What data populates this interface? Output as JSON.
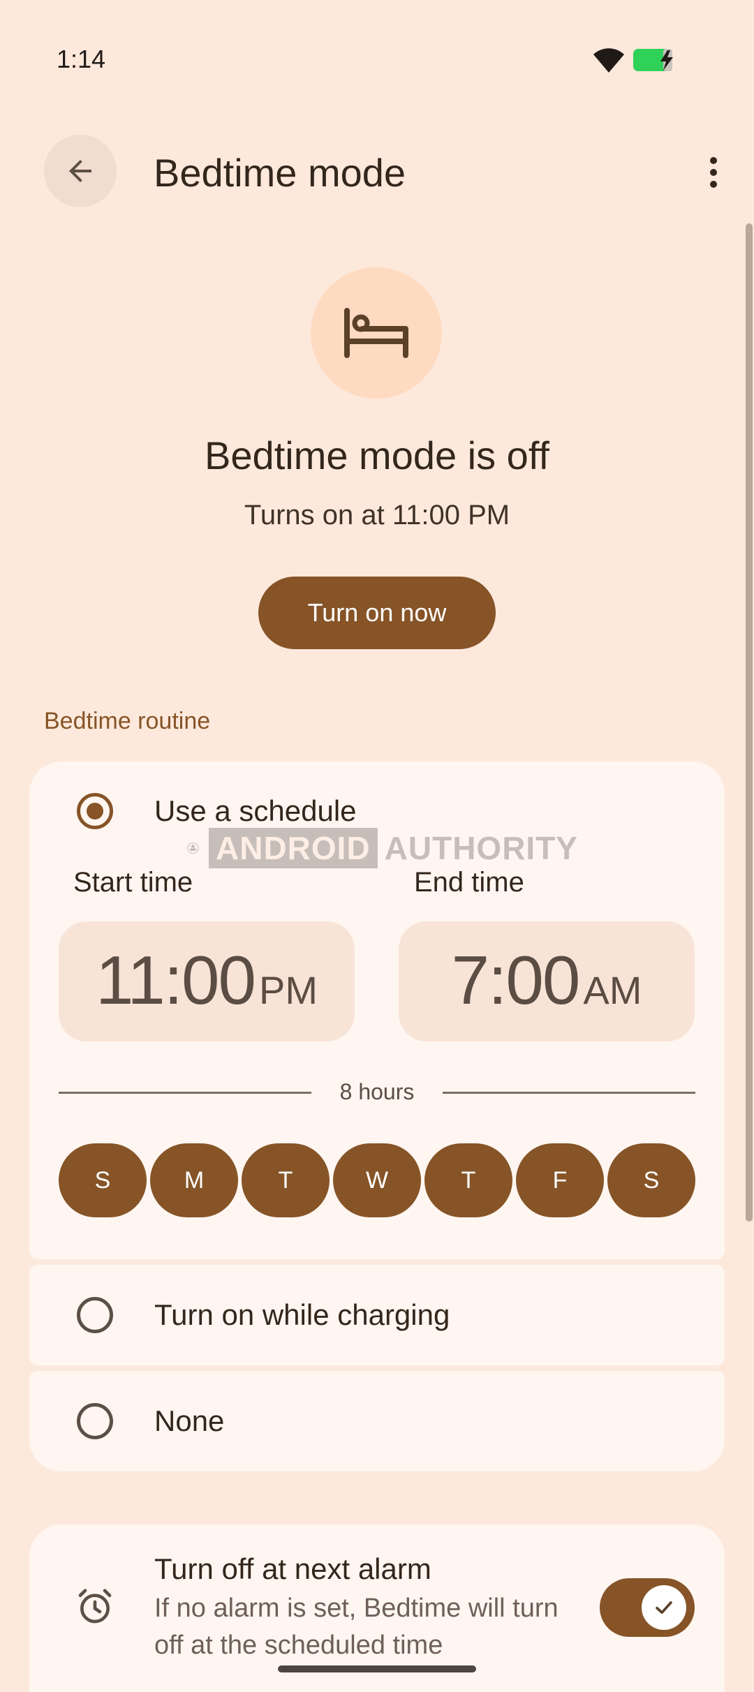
{
  "status_bar": {
    "time": "1:14"
  },
  "app_bar": {
    "title": "Bedtime mode"
  },
  "hero": {
    "title": "Bedtime mode is off",
    "subtitle": "Turns on at 11:00 PM",
    "button_label": "Turn on now"
  },
  "routine": {
    "section_label": "Bedtime routine",
    "options": [
      {
        "label": "Use a schedule",
        "selected": true
      },
      {
        "label": "Turn on while charging",
        "selected": false
      },
      {
        "label": "None",
        "selected": false
      }
    ],
    "start_label": "Start time",
    "start_time": "11:00",
    "start_ampm": "PM",
    "end_label": "End time",
    "end_time": "7:00",
    "end_ampm": "AM",
    "duration": "8 hours",
    "days": [
      "S",
      "M",
      "T",
      "W",
      "T",
      "F",
      "S"
    ]
  },
  "alarm": {
    "title": "Turn off at next alarm",
    "description": "If no alarm is set, Bedtime will turn off at the scheduled time",
    "toggle_on": true
  },
  "watermark": {
    "text1": "ANDROID",
    "text2": "AUTHORITY"
  },
  "colors": {
    "background": "#fde9dc",
    "accent": "#865427",
    "card": "#fff6f1",
    "time_box": "#f8e4d7",
    "icon_circle": "#fedac1"
  }
}
